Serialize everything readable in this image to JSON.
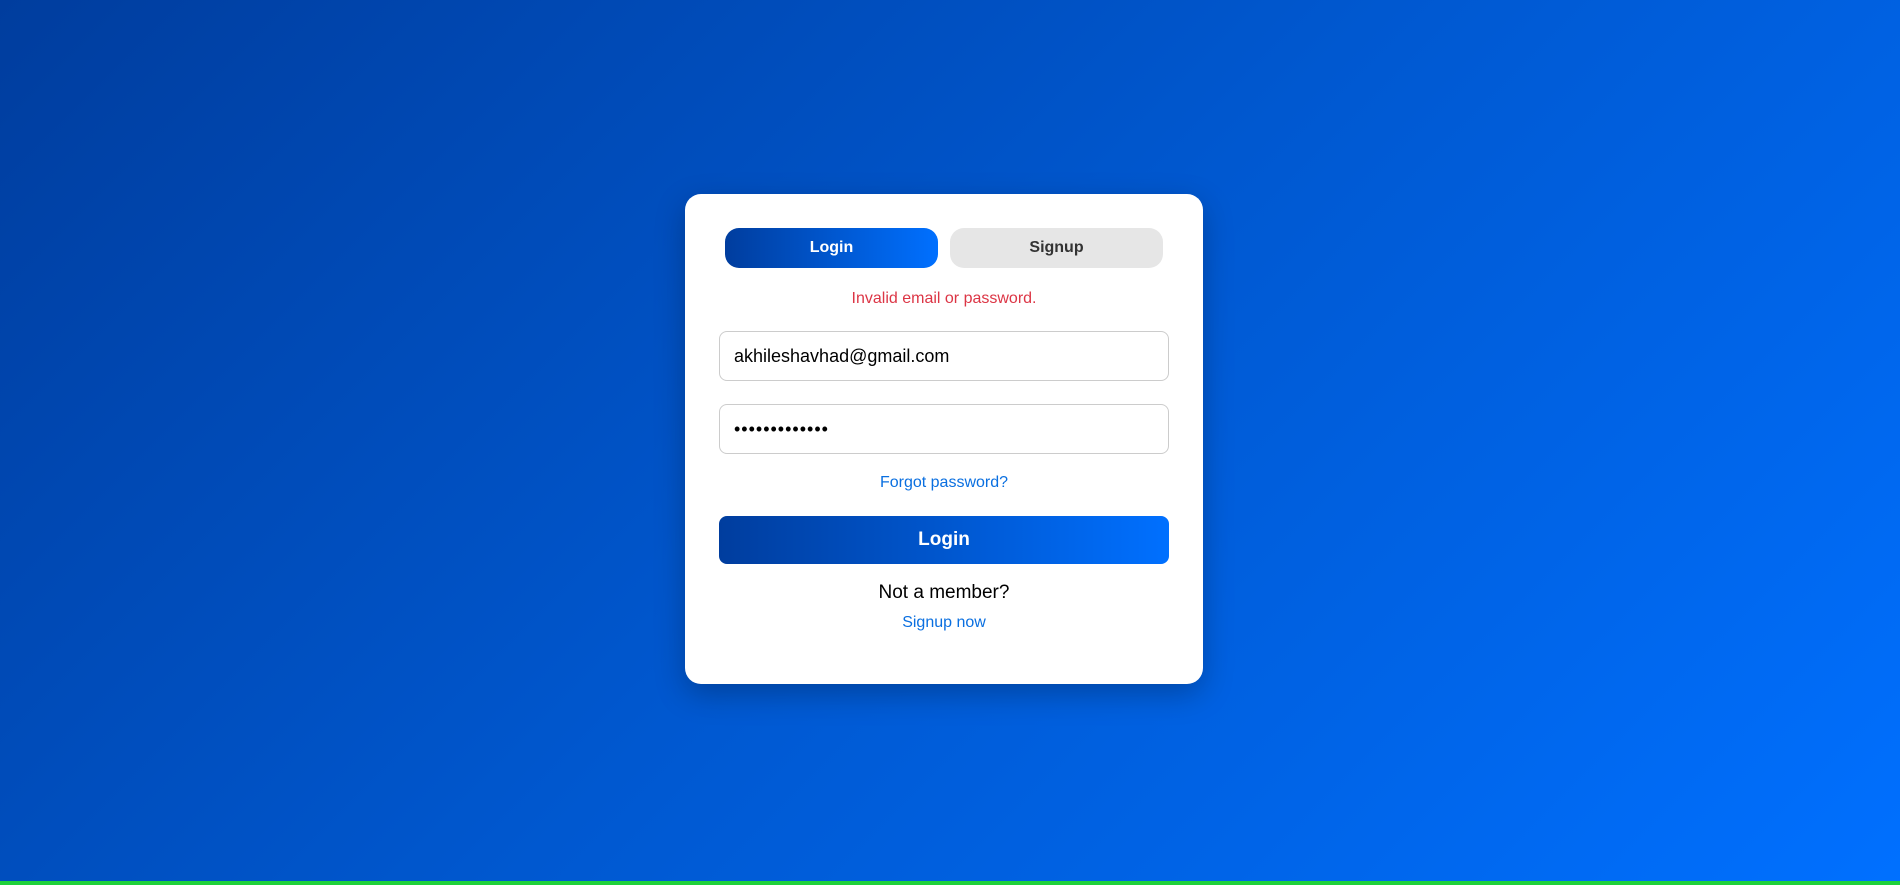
{
  "tabs": {
    "login_label": "Login",
    "signup_label": "Signup",
    "active": "Login"
  },
  "error_message": "Invalid email or password.",
  "form": {
    "email_value": "akhileshavhad@gmail.com",
    "password_value": "•••••••••••••",
    "forgot_label": "Forgot password?",
    "submit_label": "Login"
  },
  "footer": {
    "prompt": "Not a member?",
    "signup_link": "Signup now"
  },
  "colors": {
    "accent_start": "#003d9e",
    "accent_end": "#0070ff",
    "error": "#dc3545",
    "link": "#0a6fe0",
    "inactive_tab": "#e6e6e6"
  }
}
